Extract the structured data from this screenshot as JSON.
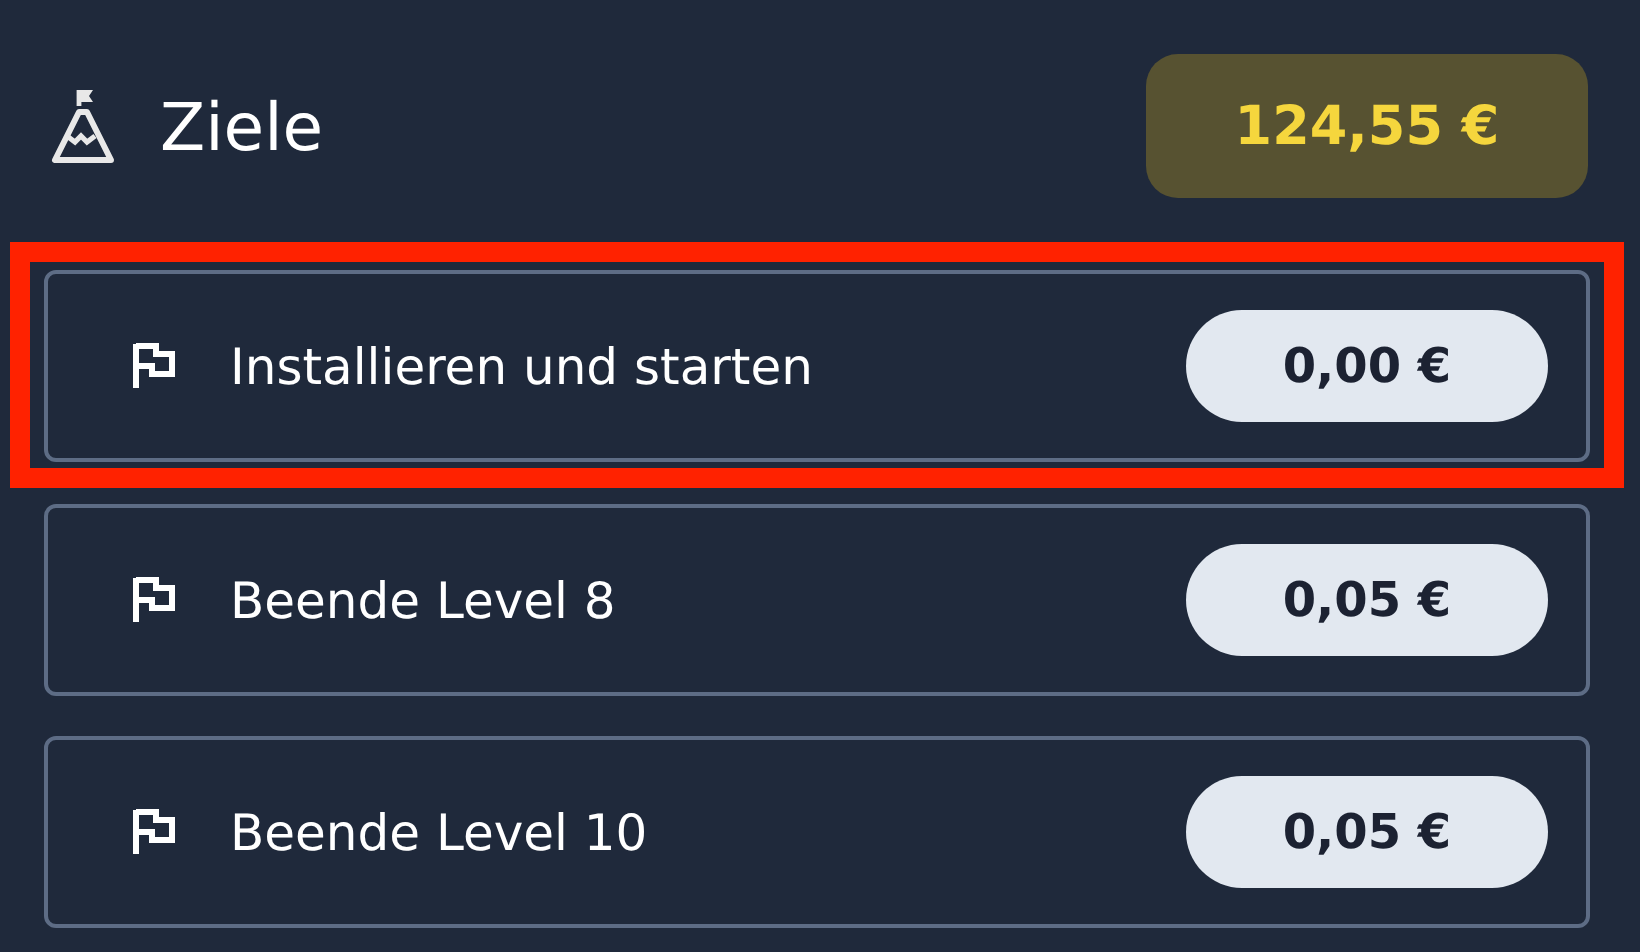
{
  "header": {
    "title": "Ziele",
    "balance": "124,55 €"
  },
  "goals": [
    {
      "label": "Installieren und starten",
      "reward": "0,00 €",
      "highlighted": true
    },
    {
      "label": "Beende Level 8",
      "reward": "0,05 €",
      "highlighted": false
    },
    {
      "label": "Beende Level 10",
      "reward": "0,05 €",
      "highlighted": false
    }
  ]
}
